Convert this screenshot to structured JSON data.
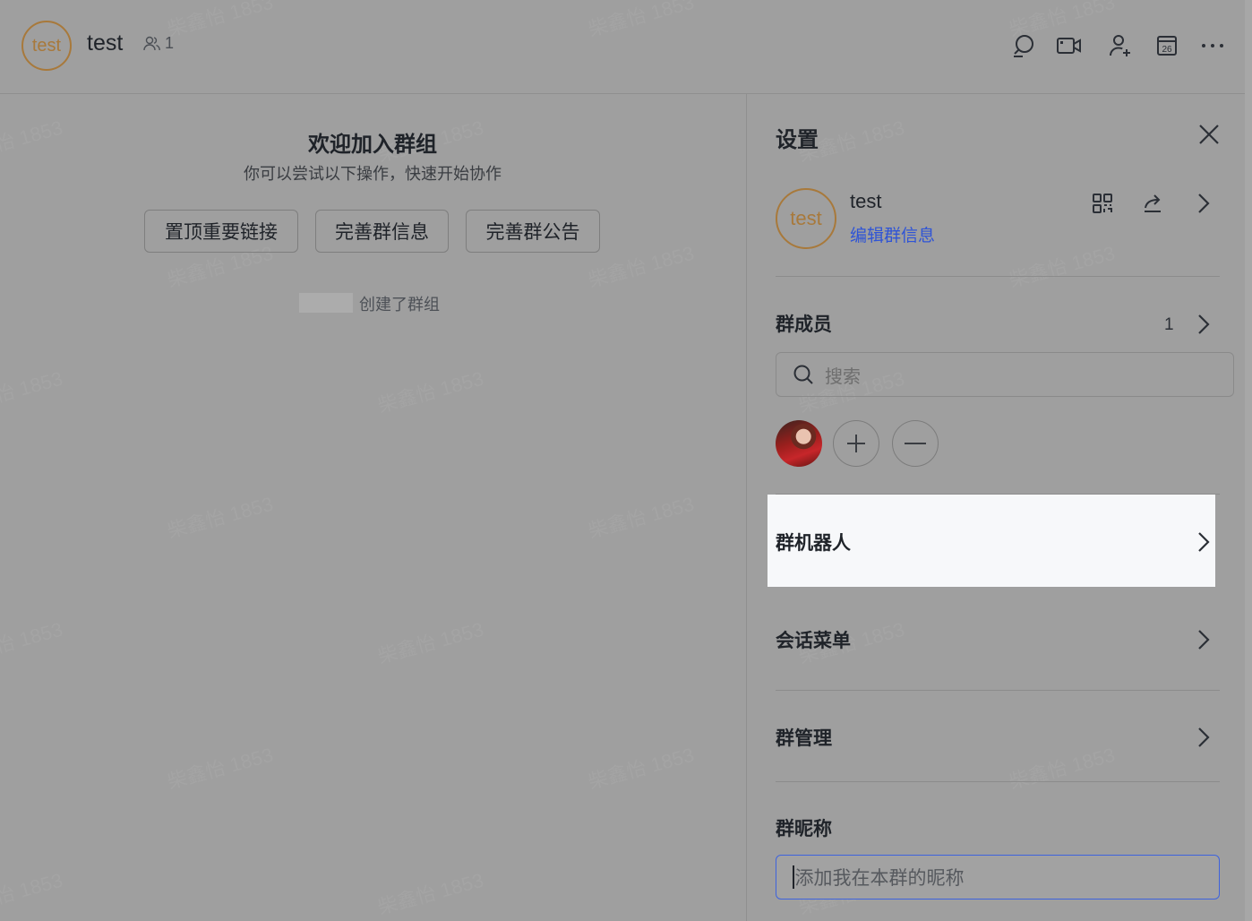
{
  "header": {
    "avatar_text": "test",
    "title": "test",
    "member_count": "1",
    "icons": [
      "search-chat-icon",
      "video-call-icon",
      "add-member-icon",
      "calendar-icon",
      "more-icon"
    ],
    "calendar_day": "26"
  },
  "welcome": {
    "title": "欢迎加入群组",
    "subtitle": "你可以尝试以下操作，快速开始协作",
    "actions": [
      "置顶重要链接",
      "完善群信息",
      "完善群公告"
    ],
    "created_text": "创建了群组"
  },
  "settings": {
    "title": "设置",
    "group": {
      "avatar_text": "test",
      "name": "test",
      "edit_link": "编辑群信息"
    },
    "members": {
      "title": "群成员",
      "count": "1",
      "search_placeholder": "搜索"
    },
    "rows": {
      "bots": "群机器人",
      "chat_menu": "会话菜单",
      "manage": "群管理"
    },
    "nickname": {
      "title": "群昵称",
      "placeholder": "添加我在本群的昵称"
    }
  },
  "watermark": "柴鑫怡 1853",
  "colors": {
    "accent": "#2f54d6",
    "avatar_ring": "#a8793b",
    "dim_overlay": "#9f9f9f",
    "highlight": "#f7f8fa"
  }
}
